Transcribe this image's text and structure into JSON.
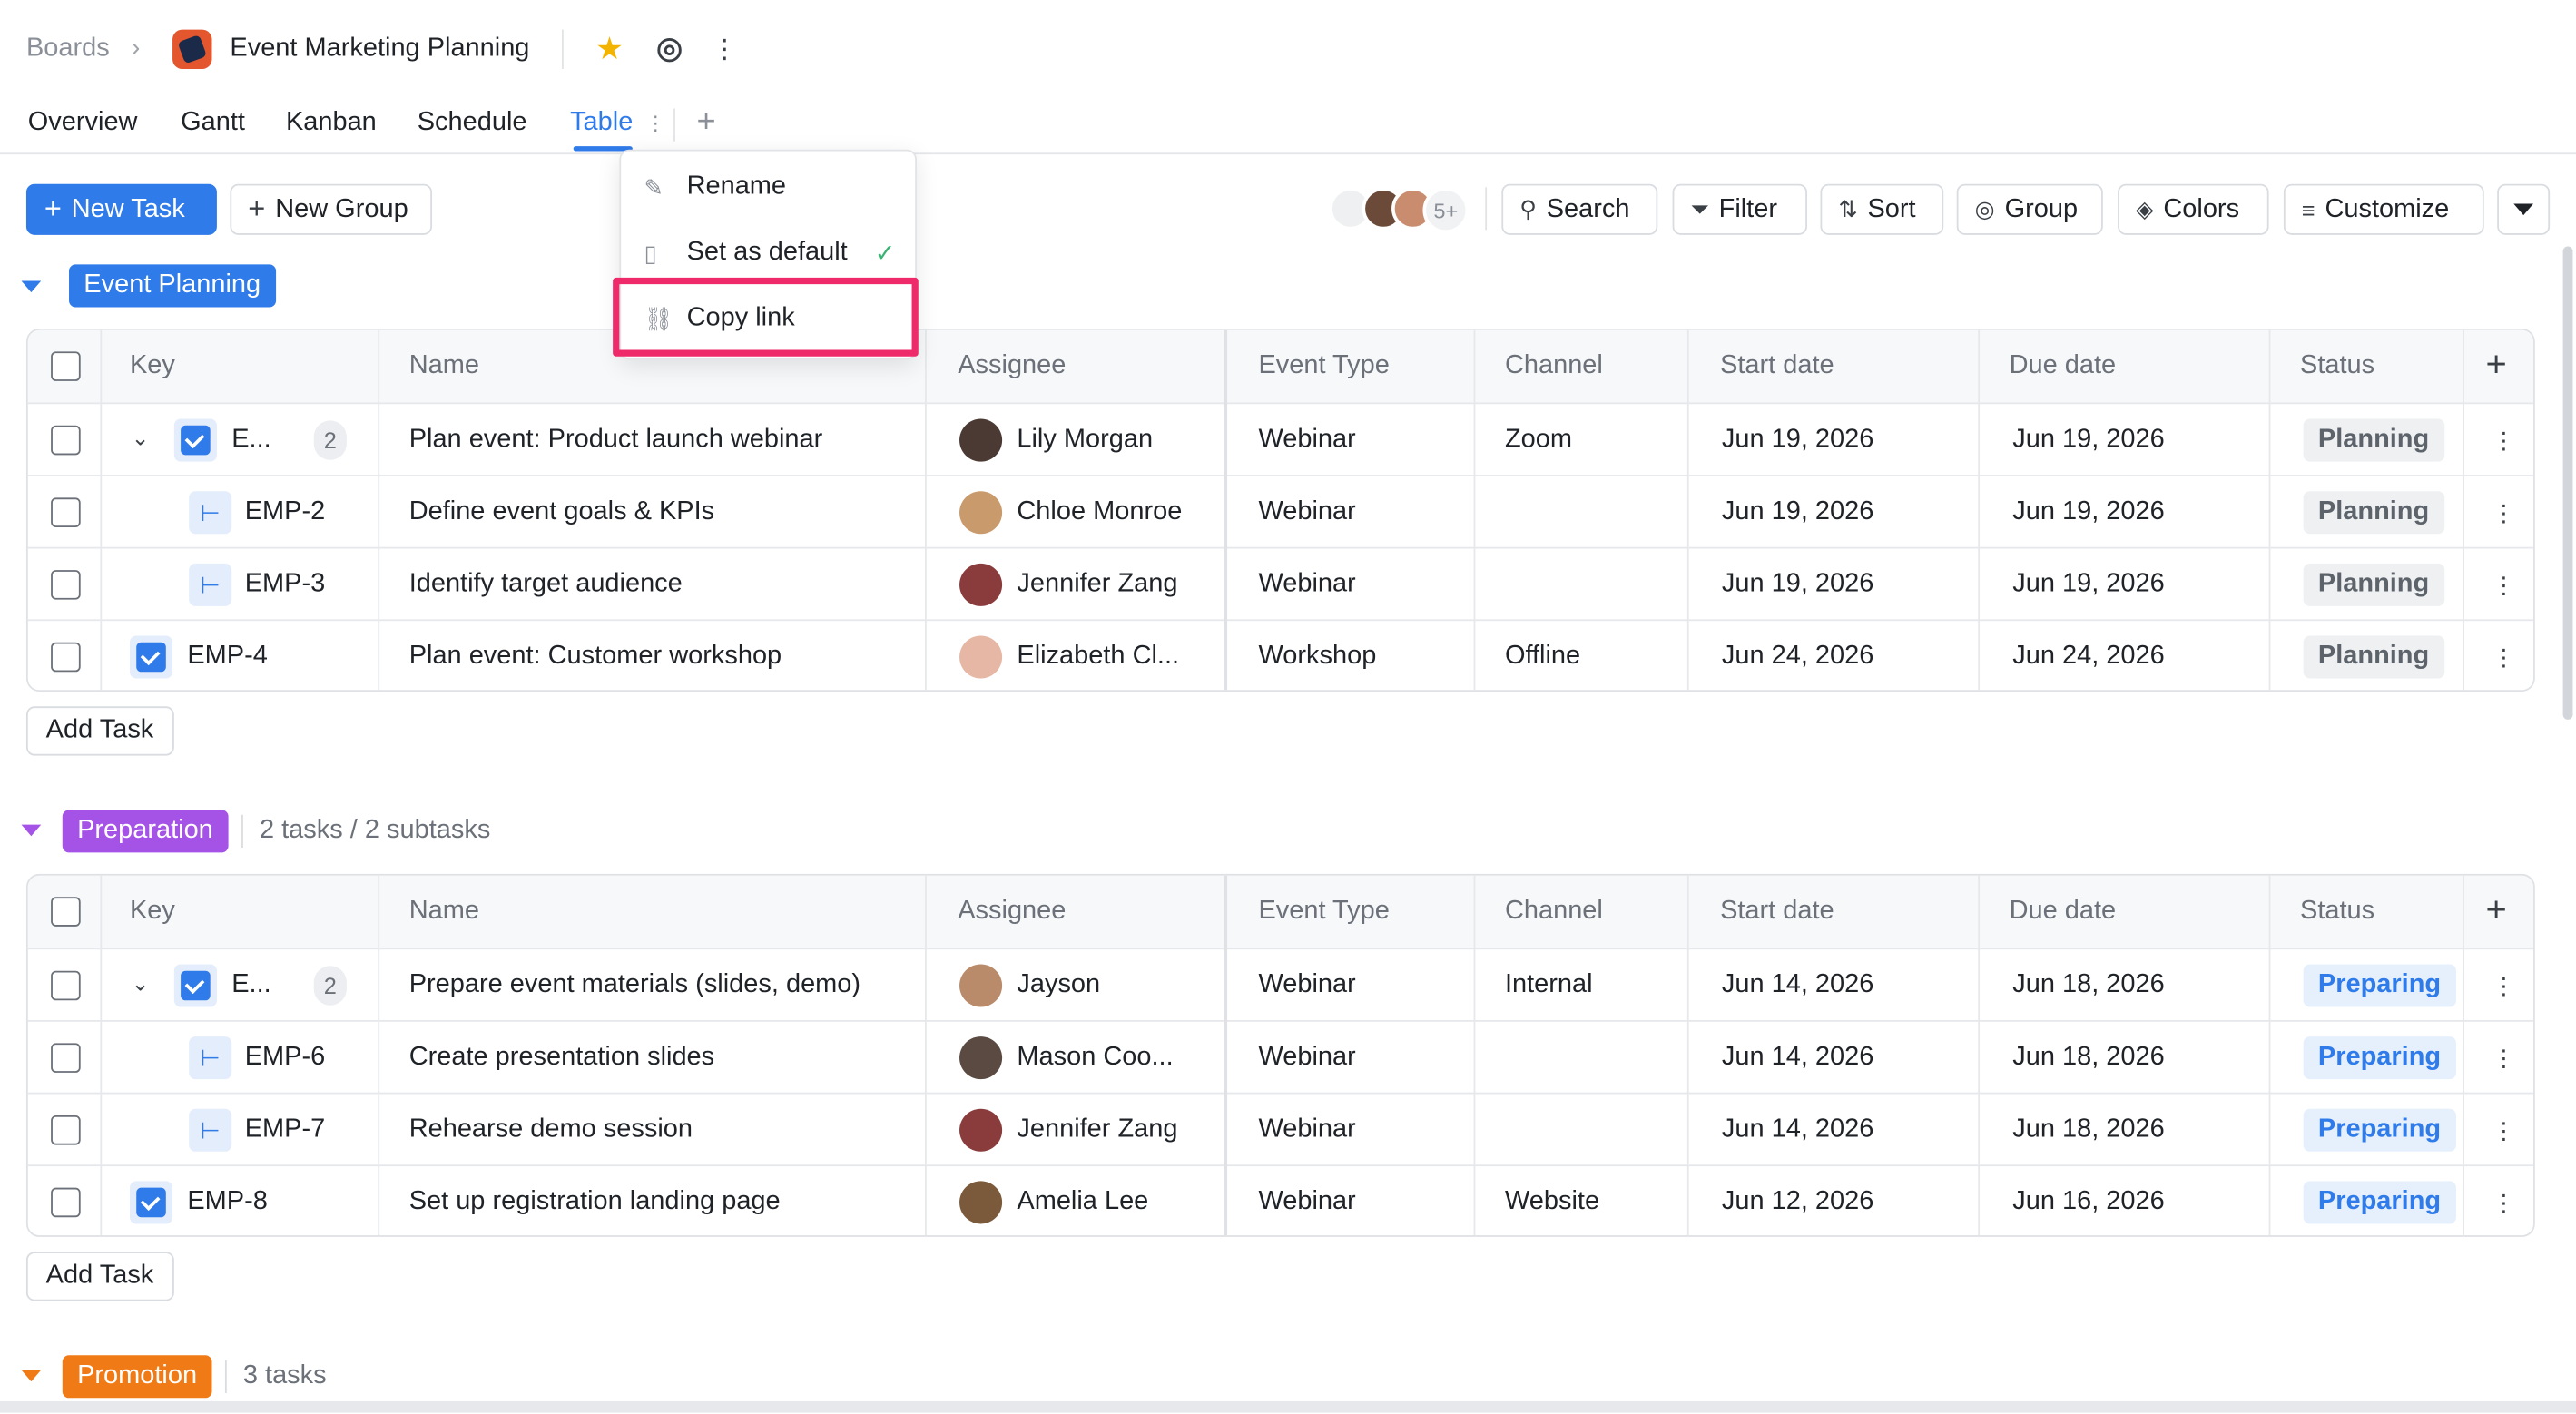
{
  "header": {
    "breadcrumb_root": "Boards",
    "board_title": "Event Marketing Planning"
  },
  "tabs": [
    {
      "label": "Overview"
    },
    {
      "label": "Gantt"
    },
    {
      "label": "Kanban"
    },
    {
      "label": "Schedule"
    },
    {
      "label": "Table",
      "active": true
    }
  ],
  "toolbar": {
    "new_task": "New Task",
    "new_group": "New Group",
    "avatars_more": "5+",
    "search": "Search",
    "filter": "Filter",
    "sort": "Sort",
    "group": "Group",
    "colors": "Colors",
    "customize": "Customize"
  },
  "tab_menu": {
    "rename": "Rename",
    "set_default": "Set as default",
    "copy_link": "Copy link"
  },
  "columns": {
    "key": "Key",
    "name": "Name",
    "assignee": "Assignee",
    "event_type": "Event Type",
    "channel": "Channel",
    "start_date": "Start date",
    "due_date": "Due date",
    "status": "Status"
  },
  "add_task_label": "Add Task",
  "groups": [
    {
      "name": "Event Planning",
      "color": "#2f7bea",
      "meta": "",
      "rows": [
        {
          "key": "E...",
          "subcount": "2",
          "name": "Plan event: Product launch webinar",
          "assignee": "Lily Morgan",
          "event_type": "Webinar",
          "channel": "Zoom",
          "start": "Jun 19, 2026",
          "due": "Jun 19, 2026",
          "status": "Planning"
        },
        {
          "key": "EMP-2",
          "name": "Define event goals & KPIs",
          "assignee": "Chloe Monroe",
          "event_type": "Webinar",
          "channel": "",
          "start": "Jun 19, 2026",
          "due": "Jun 19, 2026",
          "status": "Planning"
        },
        {
          "key": "EMP-3",
          "name": "Identify target audience",
          "assignee": "Jennifer Zang",
          "event_type": "Webinar",
          "channel": "",
          "start": "Jun 19, 2026",
          "due": "Jun 19, 2026",
          "status": "Planning"
        },
        {
          "key": "EMP-4",
          "name": "Plan event: Customer workshop",
          "assignee": "Elizabeth Cl...",
          "event_type": "Workshop",
          "channel": "Offline",
          "start": "Jun 24, 2026",
          "due": "Jun 24, 2026",
          "status": "Planning"
        }
      ]
    },
    {
      "name": "Preparation",
      "color": "#a553e6",
      "meta": "2 tasks / 2 subtasks",
      "rows": [
        {
          "key": "E...",
          "subcount": "2",
          "name": "Prepare event materials (slides, demo)",
          "assignee": "Jayson",
          "event_type": "Webinar",
          "channel": "Internal",
          "start": "Jun 14, 2026",
          "due": "Jun 18, 2026",
          "status": "Preparing"
        },
        {
          "key": "EMP-6",
          "name": "Create presentation slides",
          "assignee": "Mason Coo...",
          "event_type": "Webinar",
          "channel": "",
          "start": "Jun 14, 2026",
          "due": "Jun 18, 2026",
          "status": "Preparing"
        },
        {
          "key": "EMP-7",
          "name": "Rehearse demo session",
          "assignee": "Jennifer Zang",
          "event_type": "Webinar",
          "channel": "",
          "start": "Jun 14, 2026",
          "due": "Jun 18, 2026",
          "status": "Preparing"
        },
        {
          "key": "EMP-8",
          "name": "Set up registration landing page",
          "assignee": "Amelia Lee",
          "event_type": "Webinar",
          "channel": "Website",
          "start": "Jun 12, 2026",
          "due": "Jun 16, 2026",
          "status": "Preparing"
        }
      ]
    },
    {
      "name": "Promotion",
      "color": "#f07b16",
      "meta": "3 tasks"
    }
  ]
}
